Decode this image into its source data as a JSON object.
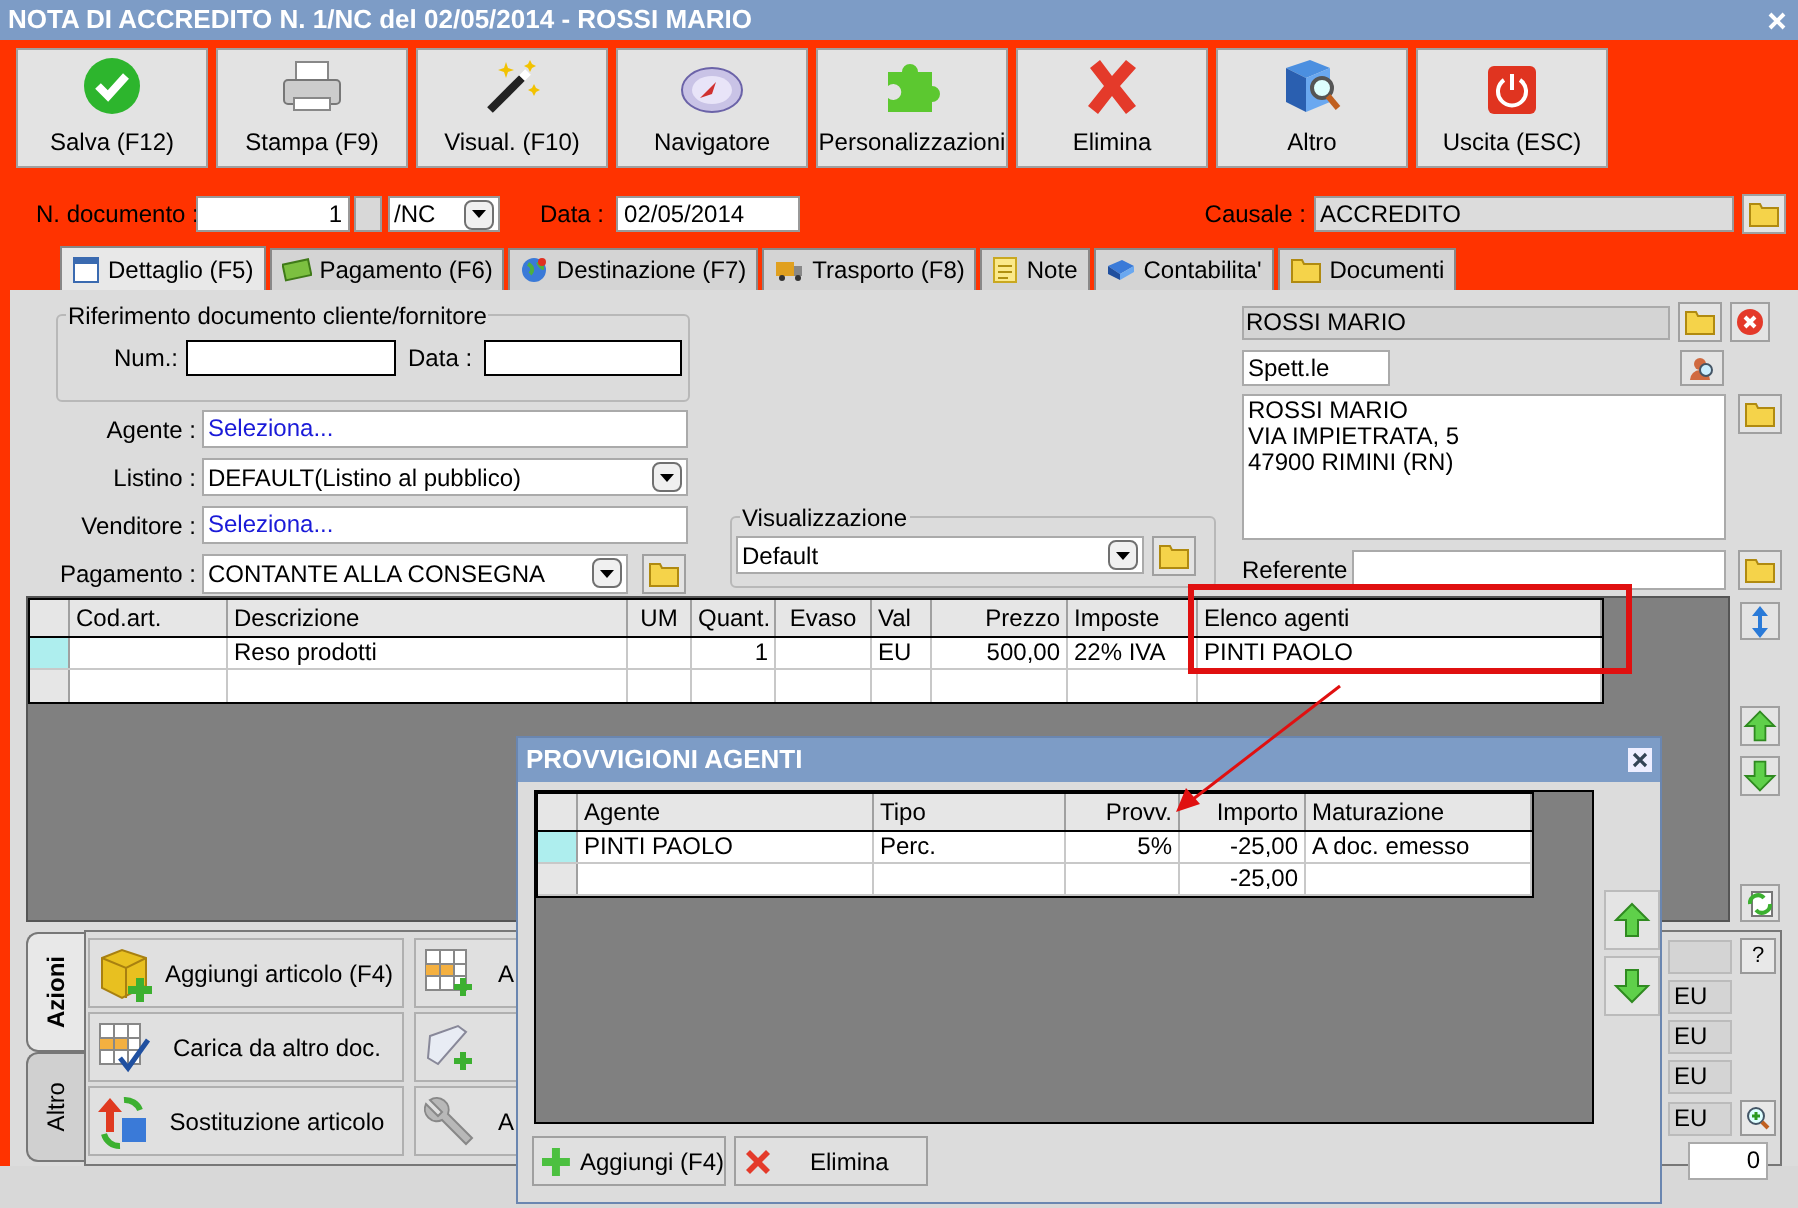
{
  "window": {
    "title": "NOTA DI ACCREDITO N. 1/NC del 02/05/2014 - ROSSI MARIO"
  },
  "toolbar": [
    {
      "label": "Salva (F12)",
      "kind": "check"
    },
    {
      "label": "Stampa (F9)",
      "kind": "printer"
    },
    {
      "label": "Visual. (F10)",
      "kind": "wand"
    },
    {
      "label": "Navigatore",
      "kind": "compass"
    },
    {
      "label": "Personalizzazioni",
      "kind": "puzzle"
    },
    {
      "label": "Elimina",
      "kind": "cross"
    },
    {
      "label": "Altro",
      "kind": "book"
    },
    {
      "label": "Uscita (ESC)",
      "kind": "power"
    }
  ],
  "header": {
    "doc_number_label": "N. documento :",
    "doc_number": "1",
    "series": "/NC",
    "date_label": "Data :",
    "date": "02/05/2014",
    "causale_label": "Causale :",
    "causale": "ACCREDITO"
  },
  "tabs": [
    {
      "label": "Dettaglio (F5)",
      "kind": "calendar",
      "selected": true
    },
    {
      "label": "Pagamento (F6)",
      "kind": "money",
      "selected": false
    },
    {
      "label": "Destinazione (F7)",
      "kind": "globe",
      "selected": false
    },
    {
      "label": "Trasporto (F8)",
      "kind": "truck",
      "selected": false
    },
    {
      "label": "Note",
      "kind": "note",
      "selected": false
    },
    {
      "label": "Contabilita'",
      "kind": "ledger",
      "selected": false
    },
    {
      "label": "Documenti",
      "kind": "folder",
      "selected": false
    }
  ],
  "reference": {
    "title": "Riferimento documento cliente/fornitore",
    "num_label": "Num.:",
    "date_label": "Data :"
  },
  "fields": [
    {
      "label": "Agente :",
      "value": "Seleziona...",
      "kind": "link"
    },
    {
      "label": "Listino :",
      "value": "DEFAULT(Listino al pubblico)",
      "kind": "dropdown"
    },
    {
      "label": "Venditore :",
      "value": "Seleziona...",
      "kind": "link"
    },
    {
      "label": "Pagamento :",
      "value": "CONTANTE ALLA CONSEGNA",
      "kind": "dropdown_folder"
    }
  ],
  "view": {
    "title": "Visualizzazione",
    "value": "Default"
  },
  "customer": {
    "name": "ROSSI MARIO",
    "salutation": "Spett.le",
    "address": [
      "ROSSI MARIO",
      "VIA IMPIETRATA, 5",
      "47900 RIMINI (RN)"
    ],
    "referente_label": "Referente"
  },
  "table": {
    "columns": [
      "Cod.art.",
      "Descrizione",
      "UM",
      "Quant.",
      "Evaso",
      "Val",
      "Prezzo",
      "Imposte",
      "Elenco agenti"
    ],
    "rows": [
      {
        "cells": [
          null,
          "Reso prodotti",
          null,
          "1",
          null,
          "EU",
          "500,00",
          "22% IVA",
          "PINTI PAOLO"
        ],
        "selected": true
      }
    ]
  },
  "bottom_tabs": [
    {
      "label": "Azioni",
      "selected": true
    },
    {
      "label": "Altro",
      "selected": false
    }
  ],
  "actions": [
    {
      "label": "Aggiungi articolo (F4)",
      "kind": "box_add"
    },
    {
      "label": "Carica da altro doc.",
      "kind": "grid_check"
    },
    {
      "label": "Sostituzione articolo",
      "kind": "swap"
    }
  ],
  "actions_2": [
    {
      "label": "A",
      "kind": "grid_add"
    },
    {
      "kind": "scroll_add"
    },
    {
      "label": "A",
      "kind": "wrench"
    }
  ],
  "totals": {
    "help": "?",
    "currencies": [
      "EU",
      "EU",
      "EU",
      "EU"
    ],
    "count": "0"
  },
  "dialog": {
    "title": "PROVVIGIONI AGENTI",
    "columns": [
      "Agente",
      "Tipo",
      "Provv.",
      "Importo",
      "Maturazione"
    ],
    "rows": [
      {
        "cells": [
          "PINTI PAOLO",
          "Perc.",
          "5%",
          "-25,00",
          "A doc. emesso"
        ],
        "selected": true
      },
      {
        "cells": [
          null,
          null,
          null,
          "-25,00",
          null
        ],
        "selected": false
      }
    ],
    "buttons": [
      {
        "label": "Aggiungi (F4)",
        "kind": "add"
      },
      {
        "label": "Elimina",
        "kind": "delete"
      }
    ]
  }
}
